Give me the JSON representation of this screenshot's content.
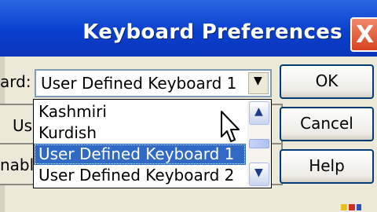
{
  "window": {
    "title": "Keyboard Preferences",
    "close_label": "X",
    "close_icon": "close-icon"
  },
  "labels": {
    "keyboard_partial": "ard:",
    "us_partial": "Us",
    "enable_partial": "nable"
  },
  "combo": {
    "value": "User Defined Keyboard 1",
    "arrow": "▼"
  },
  "dropdown": {
    "items": [
      {
        "label": "Kashmiri",
        "selected": false
      },
      {
        "label": "Kurdish",
        "selected": false
      },
      {
        "label": "User Defined Keyboard 1",
        "selected": true
      },
      {
        "label": "User Defined Keyboard 2",
        "selected": false
      }
    ],
    "scroll_up": "▲",
    "scroll_down": "▼"
  },
  "buttons": {
    "ok": "OK",
    "cancel": "Cancel",
    "help": "Help"
  },
  "colors": {
    "titlebar": "#0a3fcf",
    "selection": "#316ac5",
    "close": "#d8421e"
  }
}
